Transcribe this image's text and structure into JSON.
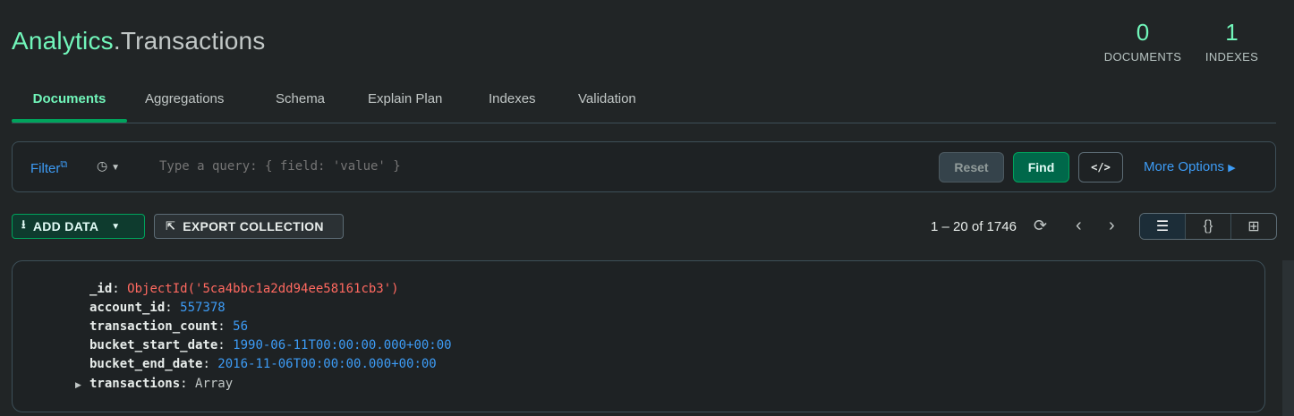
{
  "header": {
    "db_name": "Analytics",
    "separator": ".",
    "collection_name": "Transactions",
    "stats": [
      {
        "value": "0",
        "label": "DOCUMENTS"
      },
      {
        "value": "1",
        "label": "INDEXES"
      }
    ]
  },
  "tabs": [
    {
      "label": "Documents",
      "active": true
    },
    {
      "label": "Aggregations",
      "active": false
    },
    {
      "label": "Schema",
      "active": false
    },
    {
      "label": "Explain Plan",
      "active": false
    },
    {
      "label": "Indexes",
      "active": false
    },
    {
      "label": "Validation",
      "active": false
    }
  ],
  "filter": {
    "label": "Filter",
    "placeholder": "Type a query: { field: 'value' }",
    "reset_label": "Reset",
    "find_label": "Find",
    "code_label": "</>",
    "more_options_label": "More Options"
  },
  "toolbar": {
    "add_data_label": "ADD DATA",
    "export_label": "EXPORT COLLECTION",
    "paging_text": "1 – 20 of 1746"
  },
  "document": {
    "fields": [
      {
        "key": "_id",
        "value": "ObjectId('5ca4bbc1a2dd94ee58161cb3')",
        "type": "oid"
      },
      {
        "key": "account_id",
        "value": "557378",
        "type": "num"
      },
      {
        "key": "transaction_count",
        "value": "56",
        "type": "num"
      },
      {
        "key": "bucket_start_date",
        "value": "1990-06-11T00:00:00.000+00:00",
        "type": "date"
      },
      {
        "key": "bucket_end_date",
        "value": "2016-11-06T00:00:00.000+00:00",
        "type": "date"
      },
      {
        "key": "transactions",
        "value": "Array",
        "type": "type"
      }
    ]
  },
  "colors": {
    "accent": "#71f6ba",
    "link": "#3d9cf6",
    "objectid": "#ff6960",
    "button_green": "#00684a"
  },
  "icons": [
    "external-link-icon",
    "clock-icon",
    "caret-down-icon",
    "code-icon",
    "caret-right-icon",
    "download-icon",
    "export-icon",
    "refresh-icon",
    "chevron-left-icon",
    "chevron-right-icon",
    "list-view-icon",
    "json-view-icon",
    "table-view-icon",
    "expand-arrow-icon"
  ]
}
